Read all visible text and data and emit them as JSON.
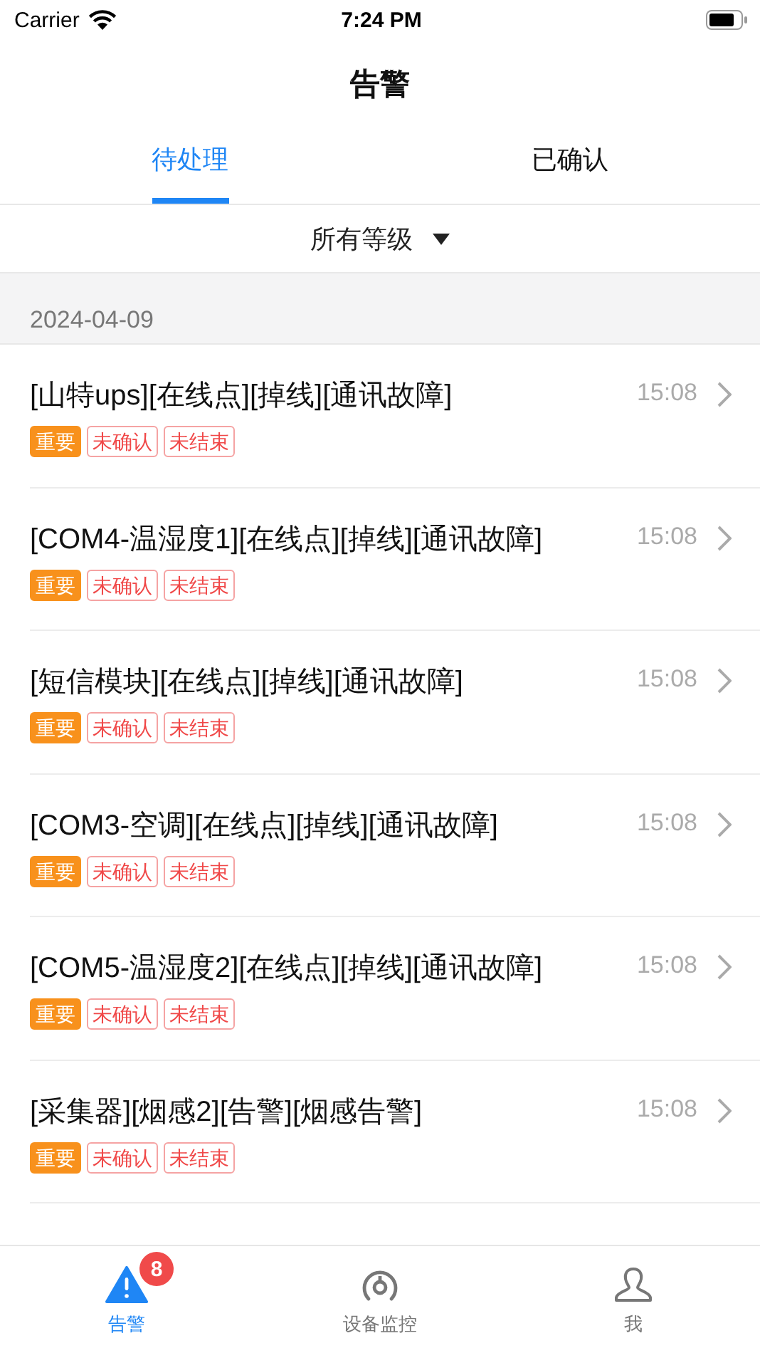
{
  "status_bar": {
    "carrier": "Carrier",
    "time": "7:24 PM"
  },
  "nav": {
    "title": "告警"
  },
  "tabs": [
    {
      "label": "待处理",
      "selected": true
    },
    {
      "label": "已确认",
      "selected": false
    }
  ],
  "filter": {
    "label": "所有等级"
  },
  "section": {
    "date": "2024-04-09"
  },
  "alarms": [
    {
      "title": "[山特ups][在线点][掉线][通讯故障]",
      "time": "15:08",
      "tags": [
        {
          "label": "重要",
          "kind": "level"
        },
        {
          "label": "未确认",
          "kind": "status"
        },
        {
          "label": "未结束",
          "kind": "status"
        }
      ]
    },
    {
      "title": "[COM4-温湿度1][在线点][掉线][通讯故障]",
      "time": "15:08",
      "tags": [
        {
          "label": "重要",
          "kind": "level"
        },
        {
          "label": "未确认",
          "kind": "status"
        },
        {
          "label": "未结束",
          "kind": "status"
        }
      ]
    },
    {
      "title": "[短信模块][在线点][掉线][通讯故障]",
      "time": "15:08",
      "tags": [
        {
          "label": "重要",
          "kind": "level"
        },
        {
          "label": "未确认",
          "kind": "status"
        },
        {
          "label": "未结束",
          "kind": "status"
        }
      ]
    },
    {
      "title": "[COM3-空调][在线点][掉线][通讯故障]",
      "time": "15:08",
      "tags": [
        {
          "label": "重要",
          "kind": "level"
        },
        {
          "label": "未确认",
          "kind": "status"
        },
        {
          "label": "未结束",
          "kind": "status"
        }
      ]
    },
    {
      "title": "[COM5-温湿度2][在线点][掉线][通讯故障]",
      "time": "15:08",
      "tags": [
        {
          "label": "重要",
          "kind": "level"
        },
        {
          "label": "未确认",
          "kind": "status"
        },
        {
          "label": "未结束",
          "kind": "status"
        }
      ]
    },
    {
      "title": "[采集器][烟感2][告警][烟感告警]",
      "time": "15:08",
      "tags": [
        {
          "label": "重要",
          "kind": "level"
        },
        {
          "label": "未确认",
          "kind": "status"
        },
        {
          "label": "未结束",
          "kind": "status"
        }
      ]
    }
  ],
  "tab_bar": [
    {
      "label": "告警",
      "kind": "alert",
      "selected": true,
      "badge": "8"
    },
    {
      "label": "设备监控",
      "kind": "gauge",
      "selected": false
    },
    {
      "label": "我",
      "kind": "person",
      "selected": false
    }
  ]
}
